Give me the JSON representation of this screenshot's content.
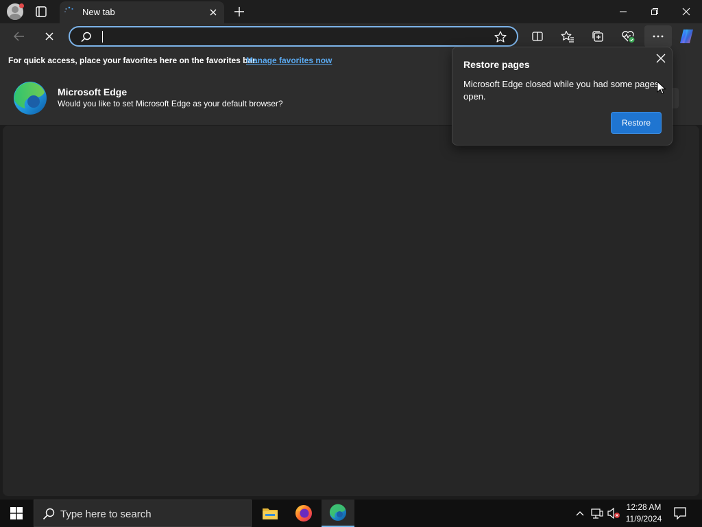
{
  "tab": {
    "title": "New tab"
  },
  "address": {
    "value": "",
    "placeholder": ""
  },
  "favorites_bar": {
    "message": "For quick access, place your favorites here on the favorites bar.",
    "link": "Manage favorites now"
  },
  "banner": {
    "title": "Microsoft Edge",
    "subtitle": "Would you like to set Microsoft Edge as your default browser?"
  },
  "popup": {
    "title": "Restore pages",
    "body": "Microsoft Edge closed while you had some pages open.",
    "button": "Restore"
  },
  "taskbar": {
    "search_placeholder": "Type here to search",
    "time": "12:28 AM",
    "date": "11/9/2024"
  },
  "colors": {
    "accent": "#1f75d1",
    "link": "#5aa9f0",
    "focus_ring": "#7cb3e8"
  },
  "icons": [
    "profile-icon",
    "tab-actions-icon",
    "loading-icon",
    "close-icon",
    "plus-icon",
    "minimize-icon",
    "restore-icon",
    "back-icon",
    "stop-icon",
    "search-icon",
    "star-icon",
    "split-screen-icon",
    "favorites-icon",
    "collections-icon",
    "performance-icon",
    "more-icon",
    "copilot-icon",
    "edge-logo-icon",
    "windows-logo-icon",
    "file-explorer-icon",
    "firefox-icon",
    "edge-icon",
    "chevron-up-icon",
    "network-icon",
    "volume-muted-icon",
    "notifications-icon"
  ]
}
